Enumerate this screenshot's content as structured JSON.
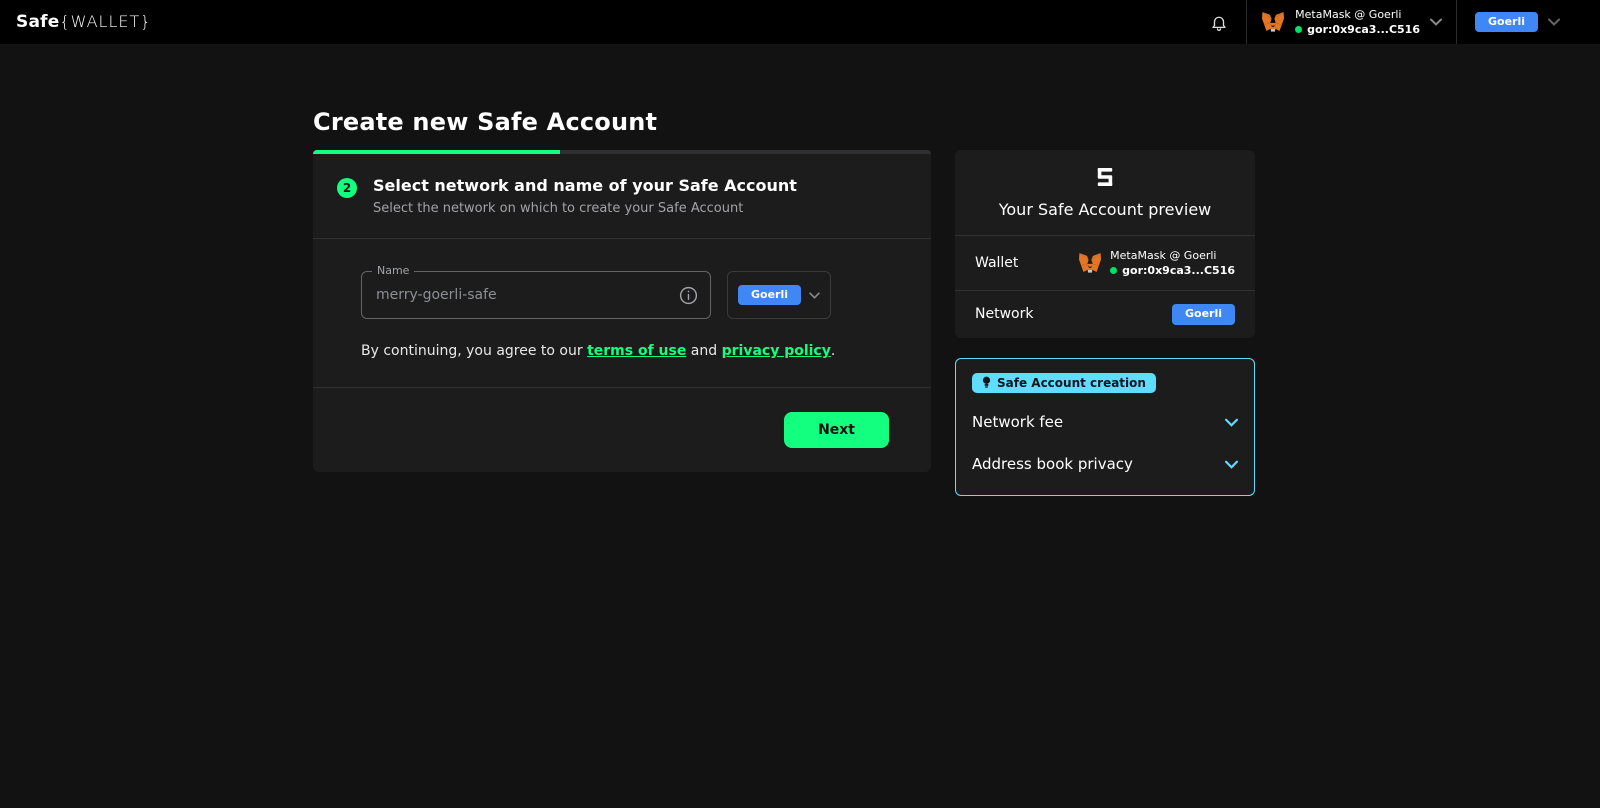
{
  "header": {
    "logo": {
      "safe": "Safe",
      "wallet": "{WALLET}"
    },
    "wallet": {
      "name": "MetaMask @ Goerli",
      "address": "gor:0x9ca3...C516"
    },
    "network": {
      "selected": "Goerli"
    }
  },
  "main": {
    "title": "Create new Safe Account",
    "progress_percent": 40,
    "step": {
      "number": "2",
      "heading": "Select network and name of your Safe Account",
      "subheading": "Select the network on which to create your Safe Account"
    },
    "form": {
      "name_label": "Name",
      "name_placeholder": "merry-goerli-safe",
      "network_selected": "Goerli",
      "terms": {
        "prefix": "By continuing, you agree to our",
        "terms_link": "terms of use",
        "conjunction": "and",
        "privacy_link": "privacy policy",
        "suffix": "."
      }
    },
    "actions": {
      "next": "Next"
    }
  },
  "preview": {
    "title": "Your Safe Account preview",
    "wallet_label": "Wallet",
    "wallet_name": "MetaMask @ Goerli",
    "wallet_address": "gor:0x9ca3...C516",
    "network_label": "Network",
    "network_value": "Goerli"
  },
  "tips": {
    "badge": "Safe Account creation",
    "items": [
      {
        "label": "Network fee"
      },
      {
        "label": "Address book privacy"
      }
    ]
  },
  "icons": {
    "notifications": "bell",
    "wallet_provider": "metamask-fox",
    "expand": "chevron-down",
    "name_help": "info-circle",
    "tip_badge": "lightbulb",
    "preview_logo": "safe-logo-mark"
  },
  "colors": {
    "accent_green": "#12FF80",
    "network_chip_blue": "#3F87F5",
    "tips_cyan": "#5FDDFF",
    "background": "#121212",
    "surface": "#1C1C1C",
    "header": "#000000",
    "status_green": "#00E266"
  }
}
